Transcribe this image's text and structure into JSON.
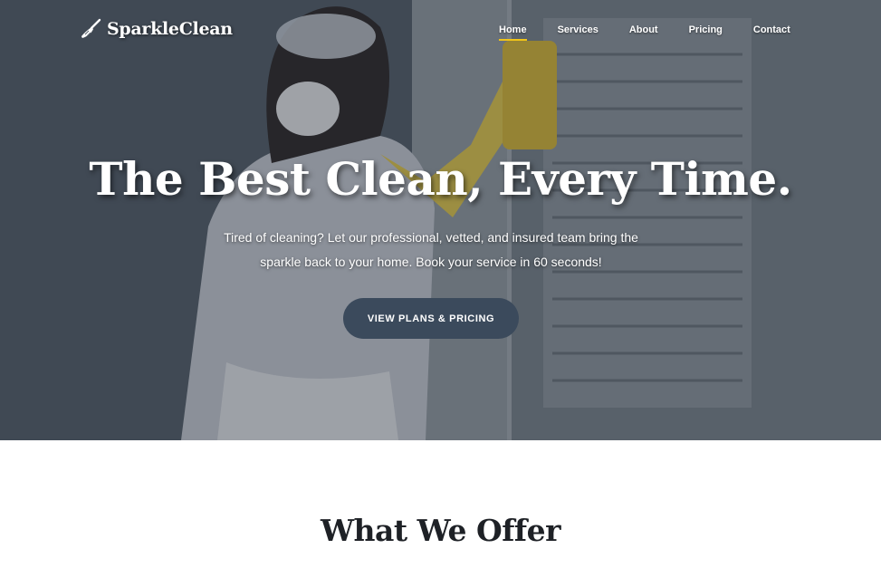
{
  "brand": {
    "name": "SparkleClean",
    "icon": "broom-icon"
  },
  "nav": {
    "items": [
      {
        "label": "Home",
        "active": true
      },
      {
        "label": "Services",
        "active": false
      },
      {
        "label": "About",
        "active": false
      },
      {
        "label": "Pricing",
        "active": false
      },
      {
        "label": "Contact",
        "active": false
      }
    ]
  },
  "hero": {
    "title": "The Best Clean, Every Time.",
    "subtitle": "Tired of cleaning? Let our professional, vetted, and insured team bring the sparkle back to your home. Book your service in 60 seconds!",
    "cta_label": "VIEW PLANS & PRICING",
    "image": "person-cleaning-window-photo"
  },
  "offer": {
    "title": "What We Offer"
  },
  "colors": {
    "accent": "#f0c419",
    "cta_bg": "#3b4a5c",
    "heading": "#1e2126"
  }
}
